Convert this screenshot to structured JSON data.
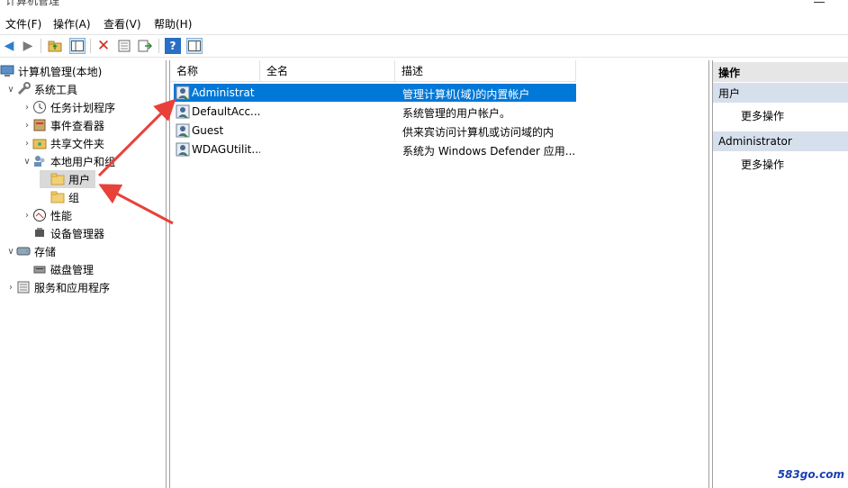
{
  "window": {
    "title": "计算机管理"
  },
  "menu": [
    "文件(F)",
    "操作(A)",
    "查看(V)",
    "帮助(H)"
  ],
  "toolbar": {
    "icons": [
      "back-icon",
      "forward-icon",
      "up-folder-icon",
      "show-hide-tree-icon",
      "delete-icon",
      "properties-icon",
      "export-icon",
      "help-icon",
      "action-pane-icon"
    ]
  },
  "tree": [
    {
      "label": "计算机管理(本地)",
      "icon": "computer-management-icon",
      "level": 0,
      "arrow": ""
    },
    {
      "label": "系统工具",
      "icon": "system-tools-icon",
      "level": 1,
      "arrow": "expanded"
    },
    {
      "label": "任务计划程序",
      "icon": "task-scheduler-icon",
      "level": 2,
      "arrow": "collapsed"
    },
    {
      "label": "事件查看器",
      "icon": "event-viewer-icon",
      "level": 2,
      "arrow": "collapsed"
    },
    {
      "label": "共享文件夹",
      "icon": "shared-folders-icon",
      "level": 2,
      "arrow": "collapsed"
    },
    {
      "label": "本地用户和组",
      "icon": "local-users-groups-icon",
      "level": 2,
      "arrow": "expanded"
    },
    {
      "label": "用户",
      "icon": "folder-icon",
      "level": 3,
      "arrow": "",
      "selected": true
    },
    {
      "label": "组",
      "icon": "folder-icon",
      "level": 3,
      "arrow": ""
    },
    {
      "label": "性能",
      "icon": "performance-icon",
      "level": 2,
      "arrow": "collapsed"
    },
    {
      "label": "设备管理器",
      "icon": "device-manager-icon",
      "level": 2,
      "arrow": ""
    },
    {
      "label": "存储",
      "icon": "storage-icon",
      "level": 1,
      "arrow": "expanded"
    },
    {
      "label": "磁盘管理",
      "icon": "disk-management-icon",
      "level": 2,
      "arrow": ""
    },
    {
      "label": "服务和应用程序",
      "icon": "services-apps-icon",
      "level": 1,
      "arrow": "collapsed"
    }
  ],
  "list": {
    "columns": [
      "名称",
      "全名",
      "描述"
    ],
    "rows": [
      {
        "name": "Administrat",
        "fullname": "",
        "description": "管理计算机(域)的内置帐户",
        "selected": true
      },
      {
        "name": "DefaultAcc...",
        "fullname": "",
        "description": "系统管理的用户帐户。"
      },
      {
        "name": "Guest",
        "fullname": "",
        "description": "供来宾访问计算机或访问域的内"
      },
      {
        "name": "WDAGUtilit...",
        "fullname": "",
        "description": "系统为 Windows Defender 应用..."
      }
    ]
  },
  "actions": {
    "title": "操作",
    "sections": [
      {
        "header": "用户",
        "items": [
          "更多操作"
        ]
      },
      {
        "header": "Administrator",
        "items": [
          "更多操作"
        ]
      }
    ]
  },
  "watermark": "583go.com",
  "colors": {
    "selection": "#0078d7",
    "annotation_arrow": "#e8413a",
    "section_header": "#d6e0ec"
  }
}
